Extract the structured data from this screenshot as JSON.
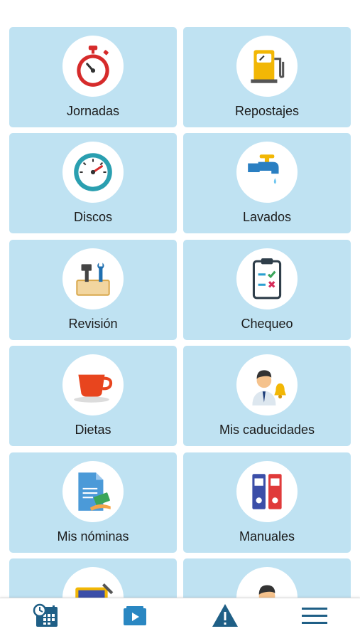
{
  "tiles": [
    {
      "label": "Jornadas",
      "icon": "stopwatch-icon"
    },
    {
      "label": "Repostajes",
      "icon": "fuel-pump-icon"
    },
    {
      "label": "Discos",
      "icon": "speedometer-icon"
    },
    {
      "label": "Lavados",
      "icon": "water-tap-icon"
    },
    {
      "label": "Revisión",
      "icon": "toolbox-icon"
    },
    {
      "label": "Chequeo",
      "icon": "checklist-clipboard-icon"
    },
    {
      "label": "Dietas",
      "icon": "coffee-cup-icon"
    },
    {
      "label": "Mis caducidades",
      "icon": "person-bell-icon"
    },
    {
      "label": "Mis nóminas",
      "icon": "payslip-document-icon"
    },
    {
      "label": "Manuales",
      "icon": "binders-icon"
    }
  ],
  "bottom_nav": [
    {
      "icon": "calendar-clock-icon"
    },
    {
      "icon": "video-folder-icon"
    },
    {
      "icon": "warning-triangle-icon"
    },
    {
      "icon": "menu-icon"
    }
  ],
  "colors": {
    "tile": "#bfe2f2",
    "nav_icon": "#1f5f86"
  }
}
